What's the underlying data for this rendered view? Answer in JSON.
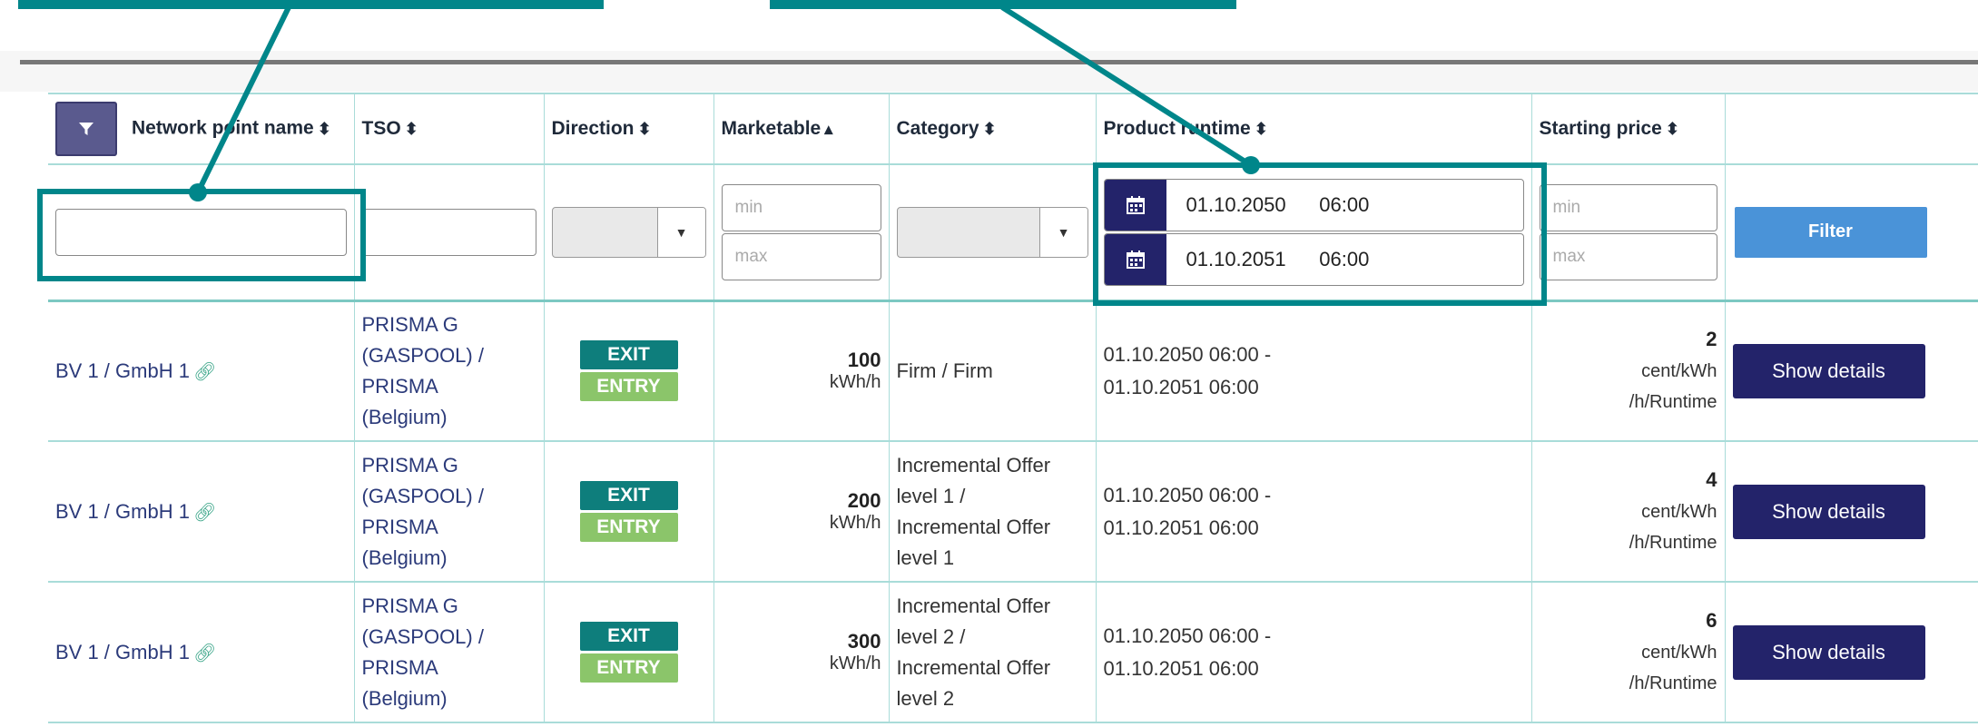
{
  "headers": {
    "network_point_name": "Network point name",
    "tso": "TSO",
    "direction": "Direction",
    "marketable": "Marketable",
    "category": "Category",
    "product_runtime": "Product runtime",
    "starting_price": "Starting price"
  },
  "filters": {
    "min_placeholder": "min",
    "max_placeholder": "max",
    "runtime_from": "01.10.2050      06:00",
    "runtime_to": "01.10.2051      06:00",
    "filter_button": "Filter"
  },
  "rows": [
    {
      "network_point": "BV 1 / GmbH 1",
      "tso_lines": [
        "PRISMA G",
        "(GASPOOL) /",
        "PRISMA",
        "(Belgium)"
      ],
      "exit_label": "EXIT",
      "entry_label": "ENTRY",
      "marketable_value": "100",
      "marketable_unit": "kWh/h",
      "category_lines": [
        "Firm / Firm"
      ],
      "runtime_line1": "01.10.2050 06:00 -",
      "runtime_line2": "01.10.2051 06:00",
      "price_value": "2",
      "price_unit1": "cent/kWh",
      "price_unit2": "/h/Runtime",
      "details_button": "Show details"
    },
    {
      "network_point": "BV 1 / GmbH 1",
      "tso_lines": [
        "PRISMA G",
        "(GASPOOL) /",
        "PRISMA",
        "(Belgium)"
      ],
      "exit_label": "EXIT",
      "entry_label": "ENTRY",
      "marketable_value": "200",
      "marketable_unit": "kWh/h",
      "category_lines": [
        "Incremental Offer",
        "level 1 /",
        "Incremental Offer",
        "level 1"
      ],
      "runtime_line1": "01.10.2050 06:00 -",
      "runtime_line2": "01.10.2051 06:00",
      "price_value": "4",
      "price_unit1": "cent/kWh",
      "price_unit2": "/h/Runtime",
      "details_button": "Show details"
    },
    {
      "network_point": "BV 1 / GmbH 1",
      "tso_lines": [
        "PRISMA G",
        "(GASPOOL) /",
        "PRISMA",
        "(Belgium)"
      ],
      "exit_label": "EXIT",
      "entry_label": "ENTRY",
      "marketable_value": "300",
      "marketable_unit": "kWh/h",
      "category_lines": [
        "Incremental Offer",
        "level 2 /",
        "Incremental Offer",
        "level 2"
      ],
      "runtime_line1": "01.10.2050 06:00 -",
      "runtime_line2": "01.10.2051 06:00",
      "price_value": "6",
      "price_unit1": "cent/kWh",
      "price_unit2": "/h/Runtime",
      "details_button": "Show details"
    }
  ],
  "icons": {
    "filter_toggle": "funnel-icon",
    "calendar": "calendar-icon",
    "link": "link-icon",
    "sort": "sort-icon"
  },
  "colors": {
    "annotation": "#00868a",
    "exit": "#0e7e7c",
    "entry": "#8bc56a",
    "primary_dark": "#23236a",
    "filter_blue": "#4a93d8"
  }
}
